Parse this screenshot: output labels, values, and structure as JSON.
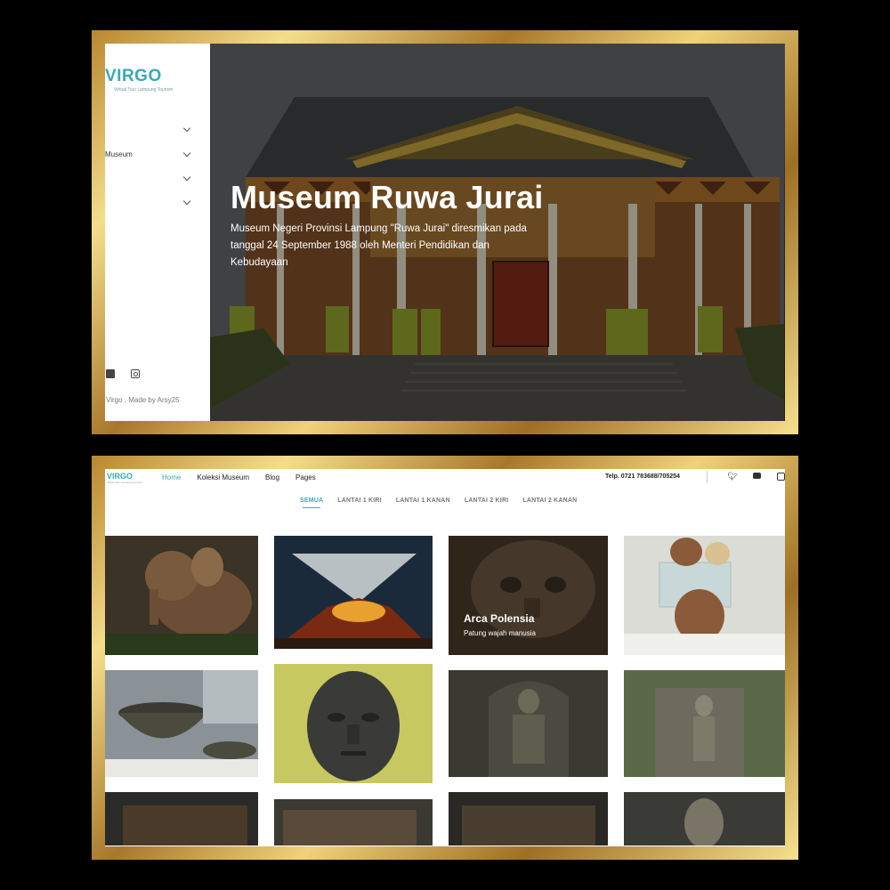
{
  "top_screen": {
    "brand": {
      "name": "VIRGO",
      "tagline": "Virtual Tour Lampung Tourism"
    },
    "nav": [
      {
        "label": ""
      },
      {
        "label": "Museum"
      },
      {
        "label": ""
      },
      {
        "label": ""
      }
    ],
    "social": [
      "youtube-icon",
      "instagram-icon"
    ],
    "footer": "Virgo , Made by Arsy25",
    "hero": {
      "title": "Museum Ruwa Jurai",
      "description": "Museum Negeri Provinsi Lampung \"Ruwa Jurai\" diresmikan pada tanggal 24 September 1988 oleh Menteri Pendidikan dan Kebudayaan"
    }
  },
  "bottom_screen": {
    "brand": {
      "name": "VIRGO",
      "tagline": "Virtual Tour Lampung Tourism"
    },
    "menu": [
      {
        "label": "Home",
        "active": true
      },
      {
        "label": "Koleksi Museum",
        "active": false
      },
      {
        "label": "Blog",
        "active": false
      },
      {
        "label": "Pages",
        "active": false
      }
    ],
    "phone": "Telp. 0721 783688/705254",
    "social": [
      "twitter-icon",
      "youtube-icon",
      "instagram-icon"
    ],
    "filters": [
      {
        "label": "SEMUA",
        "active": true
      },
      {
        "label": "LANTAI 1 KIRI",
        "active": false
      },
      {
        "label": "LANTAI 1 KANAN",
        "active": false
      },
      {
        "label": "LANTAI 2 KIRI",
        "active": false
      },
      {
        "label": "LANTAI 2 KANAN",
        "active": false
      }
    ],
    "featured_tile": {
      "title": "Arca Polensia",
      "subtitle": "Patung wajah manusia"
    }
  },
  "colors": {
    "accent": "#3aa8b5",
    "frame_gold": "#d9b45a",
    "background": "#000000"
  }
}
